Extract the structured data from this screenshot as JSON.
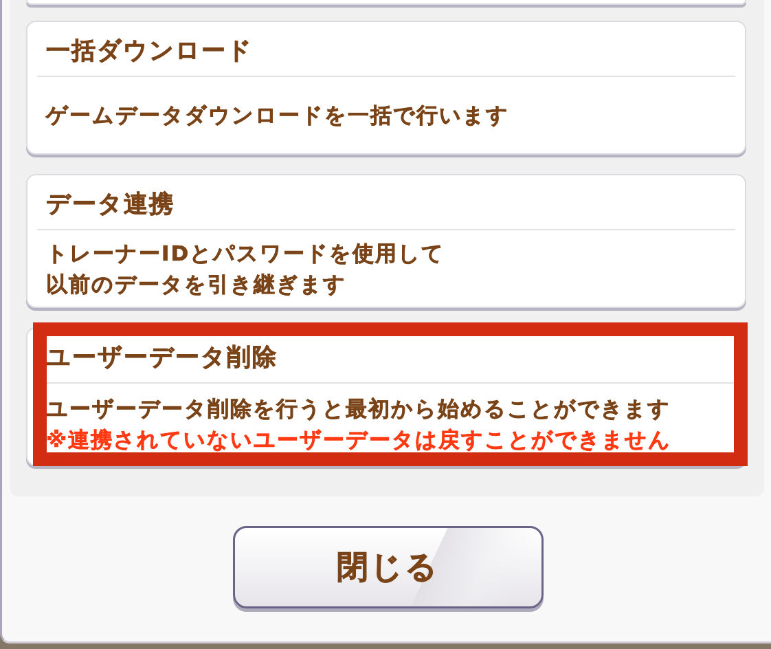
{
  "cards": [
    {
      "title": "一括ダウンロード",
      "description": [
        "ゲームデータダウンロードを一括で行います"
      ],
      "highlighted": false
    },
    {
      "title": "データ連携",
      "description": [
        "トレーナーIDとパスワードを使用して",
        "以前のデータを引き継ぎます"
      ],
      "highlighted": false
    },
    {
      "title": "ユーザーデータ削除",
      "description": [
        "ユーザーデータ削除を行うと最初から始めることができます"
      ],
      "warning": "※連携されていないユーザーデータは戻すことができません",
      "highlighted": true
    }
  ],
  "close_button": {
    "label": "閉じる"
  }
}
